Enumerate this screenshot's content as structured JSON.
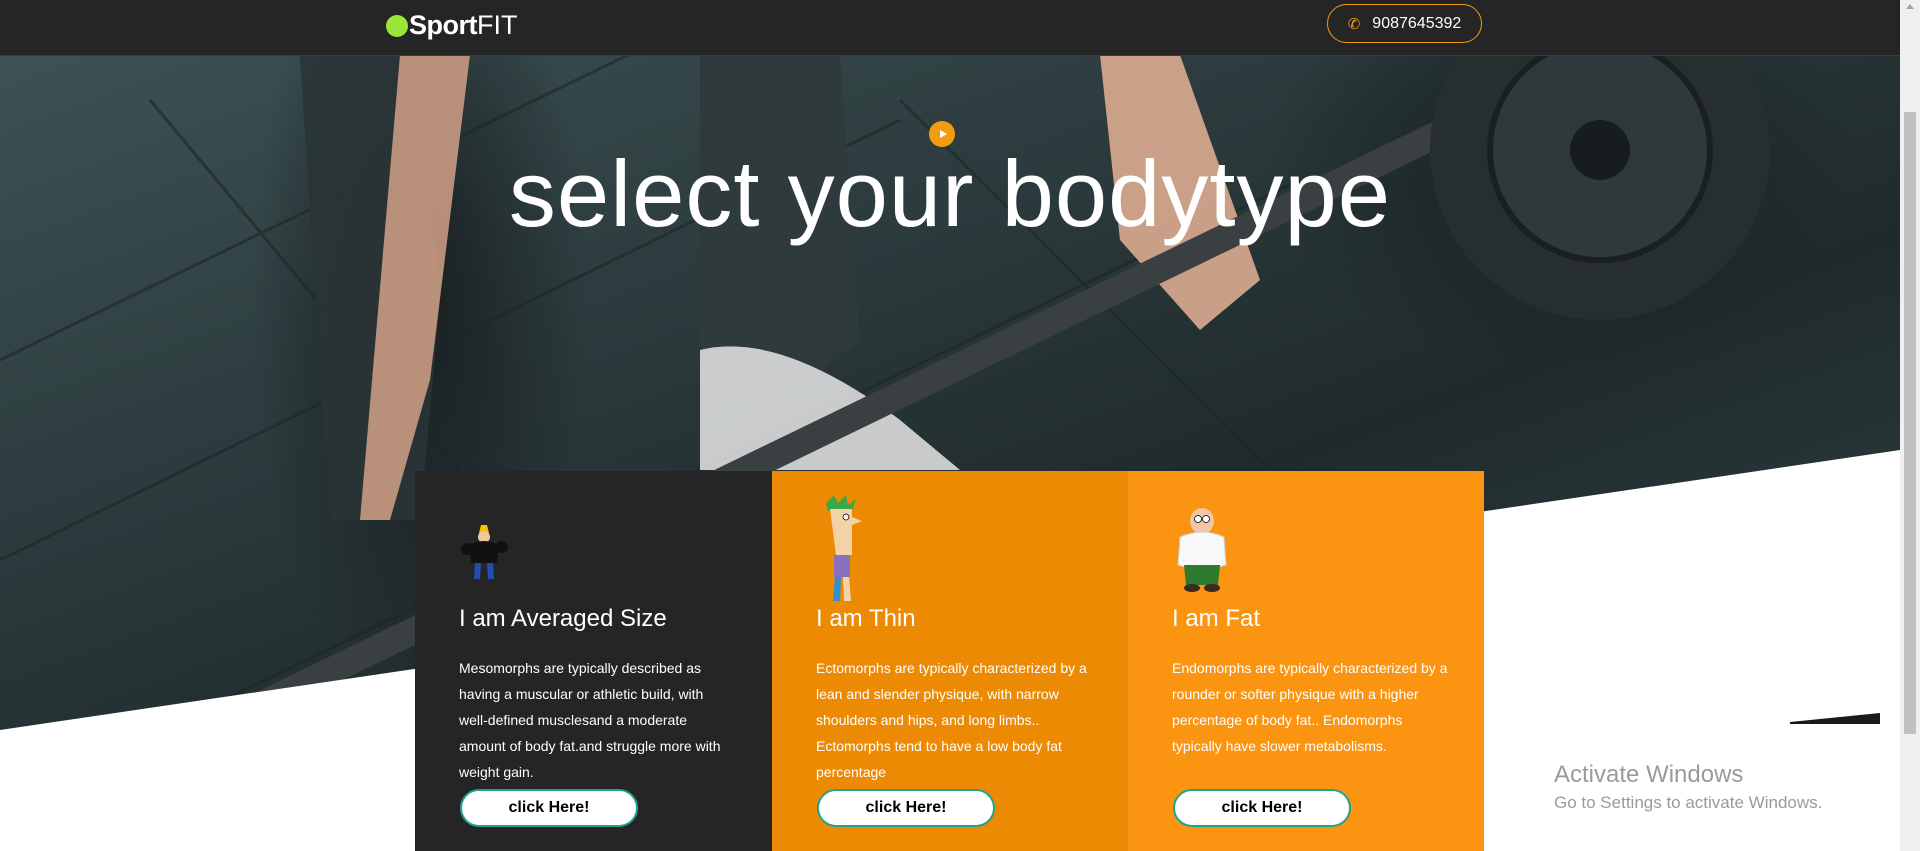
{
  "brand": {
    "name_bold": "Sport",
    "name_light": "FIT",
    "dot_color": "#9be43a"
  },
  "header": {
    "phone": "9087645392",
    "phone_icon": "phone-icon",
    "accent": "#f39c12"
  },
  "hero": {
    "title": "select your bodytype",
    "play_icon": "play-icon"
  },
  "cards": [
    {
      "title": "I am Averaged Size",
      "text": "Mesomorphs are typically described as having a muscular or athletic build, with well-defined musclesand a moderate amount of body fat.and struggle more with weight gain.",
      "button": "click Here!",
      "bg": "#252525"
    },
    {
      "title": "I am Thin",
      "text": "Ectomorphs are typically characterized by a lean and slender physique, with narrow shoulders and hips, and long limbs.. Ectomorphs tend to have a low body fat percentage",
      "button": "click Here!",
      "bg": "#ed8a04"
    },
    {
      "title": "I am Fat",
      "text": "Endomorphs are typically characterized by a rounder or softer physique with a higher percentage of body fat.. Endomorphs typically have slower metabolisms.",
      "button": "click Here!",
      "bg": "#fb9410"
    }
  ],
  "watermark": {
    "line1": "Activate Windows",
    "line2": "Go to Settings to activate Windows."
  }
}
